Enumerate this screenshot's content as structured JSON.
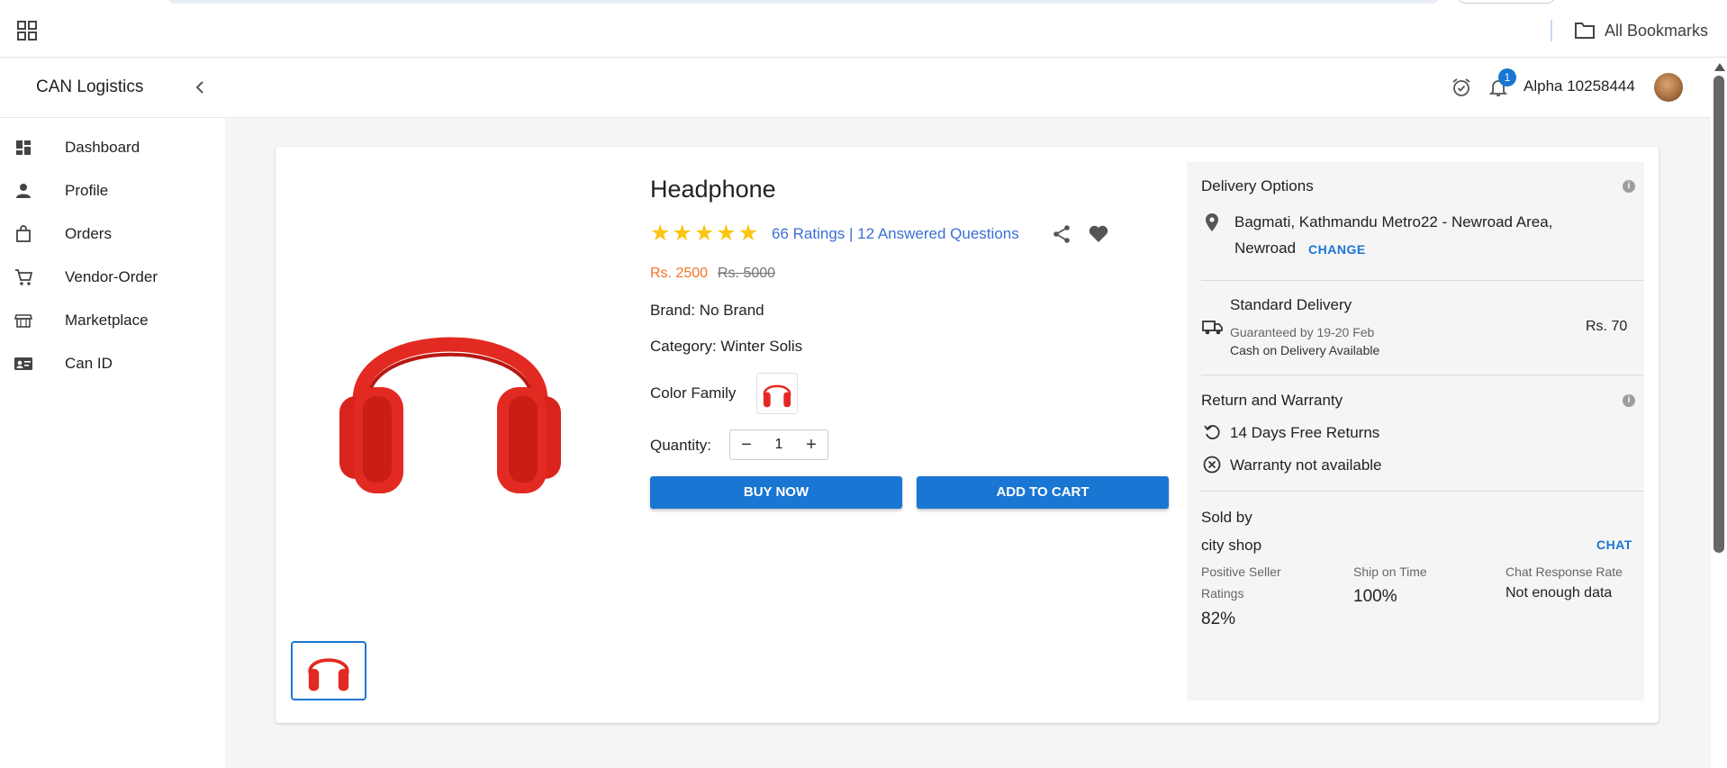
{
  "browser": {
    "bookmarks_label": "All Bookmarks"
  },
  "appbar": {
    "brand": "CAN Logistics",
    "notification_count": "1",
    "user_name": "Alpha 10258444"
  },
  "sidebar": {
    "items": [
      {
        "label": "Dashboard",
        "icon": "dashboard-icon"
      },
      {
        "label": "Profile",
        "icon": "person-icon"
      },
      {
        "label": "Orders",
        "icon": "shopping-bag-icon"
      },
      {
        "label": "Vendor-Order",
        "icon": "cart-icon"
      },
      {
        "label": "Marketplace",
        "icon": "store-icon"
      },
      {
        "label": "Can ID",
        "icon": "id-card-icon"
      }
    ]
  },
  "product": {
    "title": "Headphone",
    "rating_stars": 5,
    "ratings_text": "66 Ratings | 12 Answered Questions",
    "price": "Rs. 2500",
    "old_price": "Rs. 5000",
    "brand": "Brand: No Brand",
    "category": "Category: Winter Solis",
    "color_family_label": "Color Family",
    "quantity_label": "Quantity:",
    "quantity_value": "1",
    "buy_now_label": "BUY NOW",
    "add_to_cart_label": "ADD TO CART",
    "image_color": "#e32a22"
  },
  "delivery": {
    "title": "Delivery Options",
    "address_line1": "Bagmati, Kathmandu Metro22 - Newroad Area,",
    "address_line2": "Newroad",
    "change_label": "CHANGE",
    "standard_title": "Standard Delivery",
    "guaranteed": "Guaranteed by 19-20 Feb",
    "cod": "Cash on Delivery Available",
    "standard_price": "Rs. 70",
    "return_title": "Return and Warranty",
    "returns": "14 Days Free Returns",
    "warranty": "Warranty not available"
  },
  "seller": {
    "sold_by_label": "Sold by",
    "name": "city shop",
    "chat_label": "CHAT",
    "positive_label_1": "Positive Seller",
    "positive_label_2": "Ratings",
    "positive_value": "82%",
    "ship_label": "Ship on Time",
    "ship_value": "100%",
    "chat_rate_label": "Chat Response Rate",
    "chat_rate_value": "Not enough data"
  },
  "colors": {
    "accent": "#1976d2",
    "price": "#f57224",
    "star": "#fdc513"
  }
}
